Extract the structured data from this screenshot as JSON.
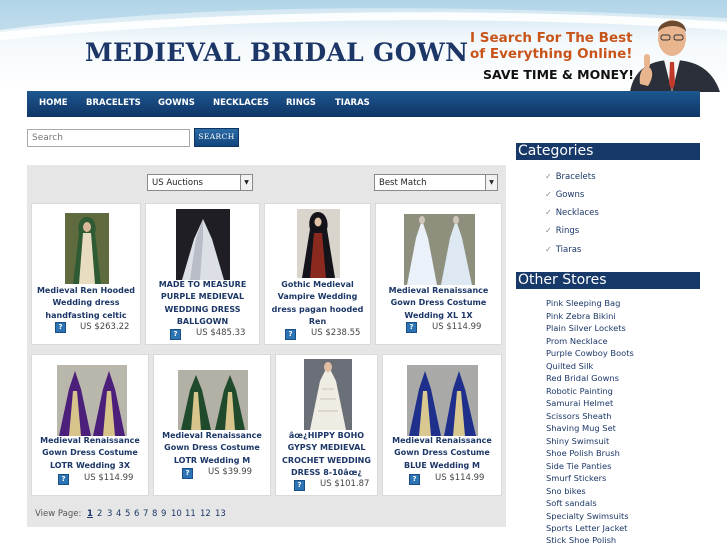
{
  "site": {
    "title": "MEDIEVAL BRIDAL GOWN",
    "promo_line1": "I Search For The Best",
    "promo_line2": "of Everything Online!",
    "promo_tagline": "SAVE TIME & MONEY!"
  },
  "nav": [
    "HOME",
    "BRACELETS",
    "GOWNS",
    "NECKLACES",
    "RINGS",
    "TIARAS"
  ],
  "search": {
    "placeholder": "Search",
    "button": "SEARCH"
  },
  "filters": {
    "source": "US Auctions",
    "sort": "Best Match"
  },
  "products": [
    {
      "title": "Medieval Ren Hooded Wedding dress handfasting celtic",
      "price": "US $263.22"
    },
    {
      "title": "MADE TO MEASURE PURPLE MEDIEVAL WEDDING DRESS BALLGOWN",
      "price": "US $485.33"
    },
    {
      "title": "Gothic Medieval Vampire Wedding dress pagan hooded Ren",
      "price": "US $238.55"
    },
    {
      "title": "Medieval Renaissance Gown Dress Costume Wedding XL 1X",
      "price": "US $114.99"
    },
    {
      "title": "Medieval Renaissance Gown Dress Costume LOTR Wedding 3X",
      "price": "US $114.99"
    },
    {
      "title": "Medieval Renaissance Gown Dress Costume LOTR Wedding M",
      "price": "US $39.99"
    },
    {
      "title": "âœ¿HIPPY BOHO GYPSY MEDIEVAL CROCHET WEDDING DRESS 8-10âœ¿",
      "price": "US $101.87"
    },
    {
      "title": "Medieval Renaissance Gown Dress Costume BLUE Wedding M",
      "price": "US $114.99"
    }
  ],
  "pager": {
    "label": "View Page:",
    "pages": [
      "1",
      "2",
      "3",
      "4",
      "5",
      "6",
      "7",
      "8",
      "9",
      "10",
      "11",
      "12",
      "13"
    ],
    "current": "1"
  },
  "sidebar": {
    "categories_heading": "Categories",
    "categories": [
      "Bracelets",
      "Gowns",
      "Necklaces",
      "Rings",
      "Tiaras"
    ],
    "stores_heading": "Other Stores",
    "stores": [
      "Pink Sleeping Bag",
      "Pink Zebra Bikini",
      "Plain Silver Lockets",
      "Prom Necklace",
      "Purple Cowboy Boots",
      "Quilted Silk",
      "Red Bridal Gowns",
      "Robotic Painting",
      "Samurai Helmet",
      "Scissors Sheath",
      "Shaving Mug Set",
      "Shiny Swimsuit",
      "Shoe Polish Brush",
      "Side Tie Panties",
      "Smurf Stickers",
      "Sno bikes",
      "Soft sandals",
      "Specialty Swimsuits",
      "Sports Letter Jacket",
      "Stick Shoe Polish"
    ]
  },
  "colors": {
    "navy": "#17396a",
    "link": "#1c3767",
    "promo_orange": "#c8541a",
    "panel_grey": "#e6e6e6"
  },
  "icons": {
    "info": "info-icon",
    "check": "checkmark-icon",
    "dropdown": "chevron-down-icon"
  }
}
